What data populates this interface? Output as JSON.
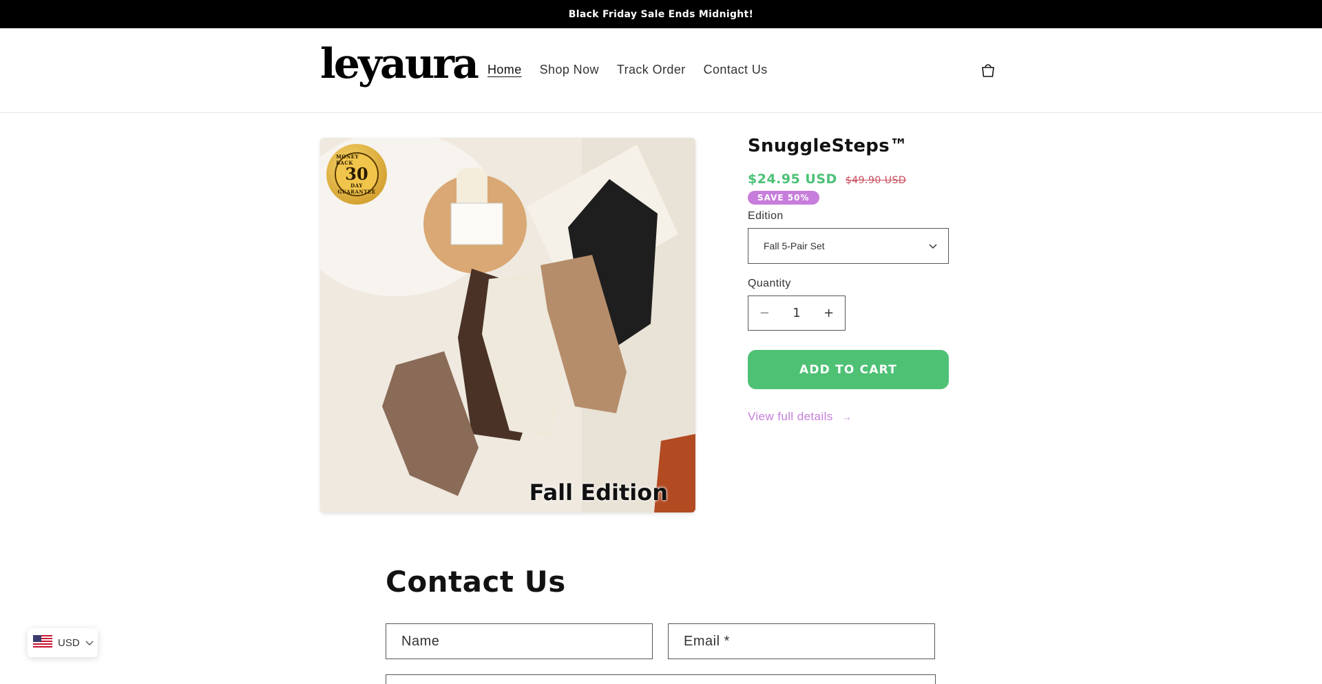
{
  "announcement": "Black Friday Sale Ends Midnight!",
  "logo": "leyaura",
  "nav": [
    "Home",
    "Shop Now",
    "Track Order",
    "Contact Us"
  ],
  "product": {
    "badge_top": "MONEY BACK",
    "badge_number": "30",
    "badge_day": "DAY",
    "badge_bottom": "GUARANTEE",
    "image_caption": "Fall Edition",
    "title": "SnuggleSteps™",
    "price": "$24.95 USD",
    "compare_price": "$49.90 USD",
    "save_badge": "SAVE 50%",
    "edition_label": "Edition",
    "edition_value": "Fall 5-Pair Set",
    "quantity_label": "Quantity",
    "quantity": "1",
    "minus": "−",
    "plus": "+",
    "add_to_cart": "ADD TO CART",
    "view_full_details": "View full details",
    "arrow": "→"
  },
  "contact": {
    "title": "Contact Us",
    "name_placeholder": "Name",
    "email_placeholder": "Email *"
  },
  "currency": {
    "code": "USD"
  },
  "colors": {
    "accent_green": "#4ec175",
    "accent_purple": "#c77ddb",
    "sale_red": "#c9495a"
  }
}
